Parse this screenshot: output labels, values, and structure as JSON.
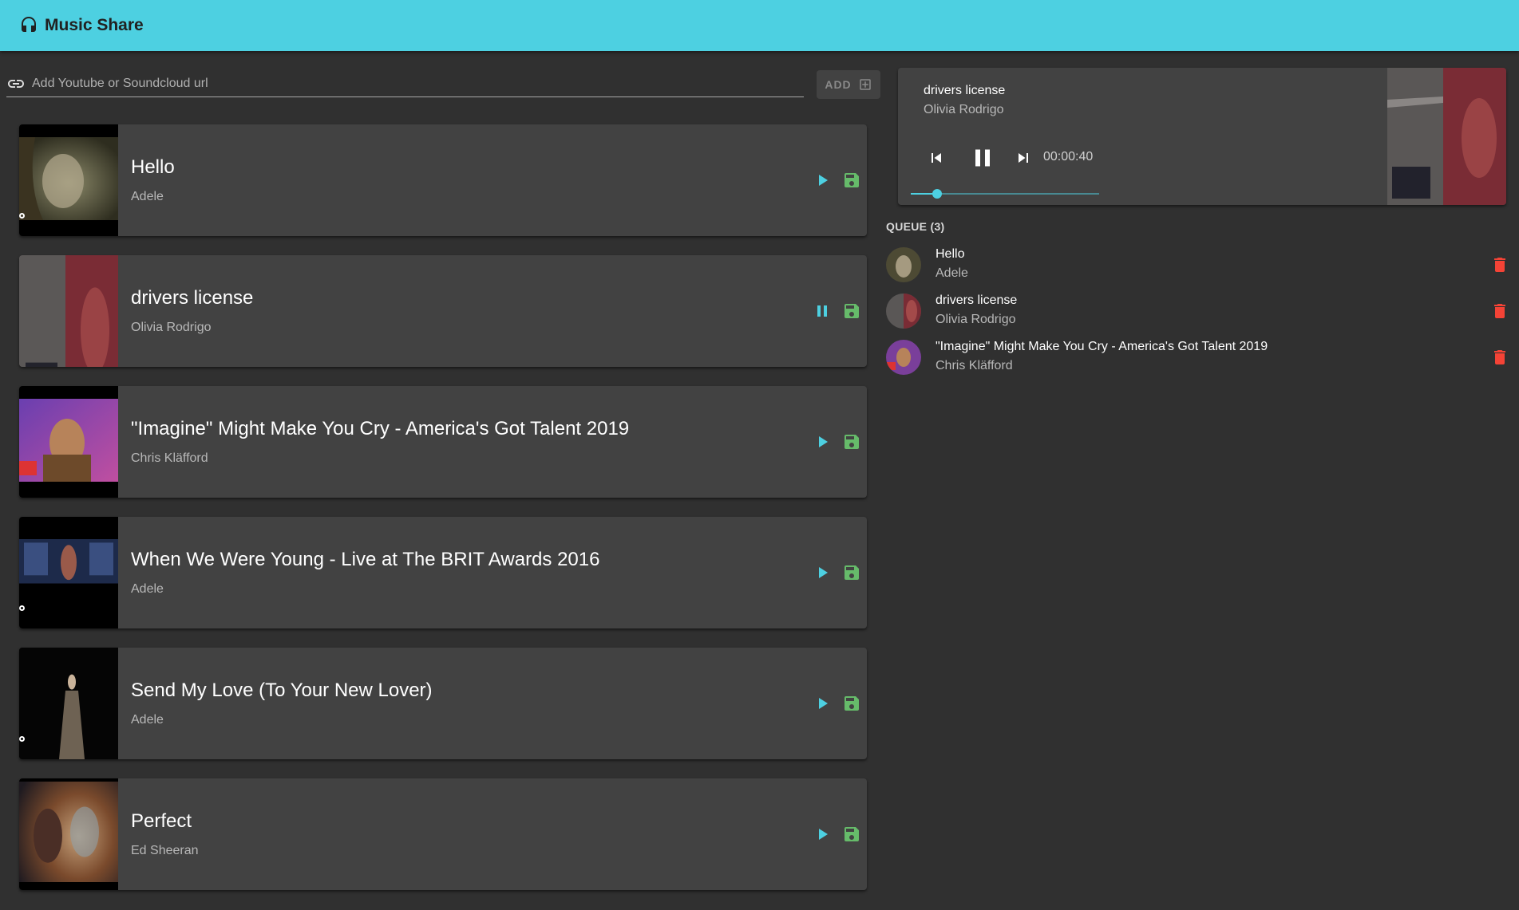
{
  "app": {
    "title": "Music Share"
  },
  "add_url": {
    "placeholder": "Add Youtube or Soundcloud url",
    "value": "",
    "button_label": "ADD"
  },
  "songs": [
    {
      "title": "Hello",
      "artist": "Adele",
      "state": "play"
    },
    {
      "title": "drivers license",
      "artist": "Olivia Rodrigo",
      "state": "pause"
    },
    {
      "title": "\"Imagine\" Might Make You Cry - America's Got Talent 2019",
      "artist": "Chris Kläfford",
      "state": "play"
    },
    {
      "title": "When We Were Young - Live at The BRIT Awards 2016",
      "artist": "Adele",
      "state": "play"
    },
    {
      "title": "Send My Love (To Your New Lover)",
      "artist": "Adele",
      "state": "play"
    },
    {
      "title": "Perfect",
      "artist": "Ed Sheeran",
      "state": "play"
    }
  ],
  "player": {
    "title": "drivers license",
    "artist": "Olivia Rodrigo",
    "elapsed": "00:00:40",
    "progress_fraction": 0.14,
    "state": "playing"
  },
  "queue": {
    "label": "QUEUE (3)",
    "items": [
      {
        "title": "Hello",
        "artist": "Adele"
      },
      {
        "title": "drivers license",
        "artist": "Olivia Rodrigo"
      },
      {
        "title": "\"Imagine\" Might Make You Cry - America's Got Talent 2019",
        "artist": "Chris Kläfford"
      }
    ]
  },
  "colors": {
    "accent": "#4dd0e1",
    "save": "#66bb6a",
    "delete": "#f44336",
    "background": "#303030",
    "card": "#424242"
  },
  "icons": {
    "logo": "headphones-icon",
    "url_field": "link-icon",
    "add_button": "add-box-icon",
    "song_play": "play-icon",
    "song_pause": "pause-icon",
    "song_save": "save-icon",
    "player_prev": "skip-previous-icon",
    "player_pause": "pause-icon",
    "player_next": "skip-next-icon",
    "queue_delete": "delete-icon"
  }
}
